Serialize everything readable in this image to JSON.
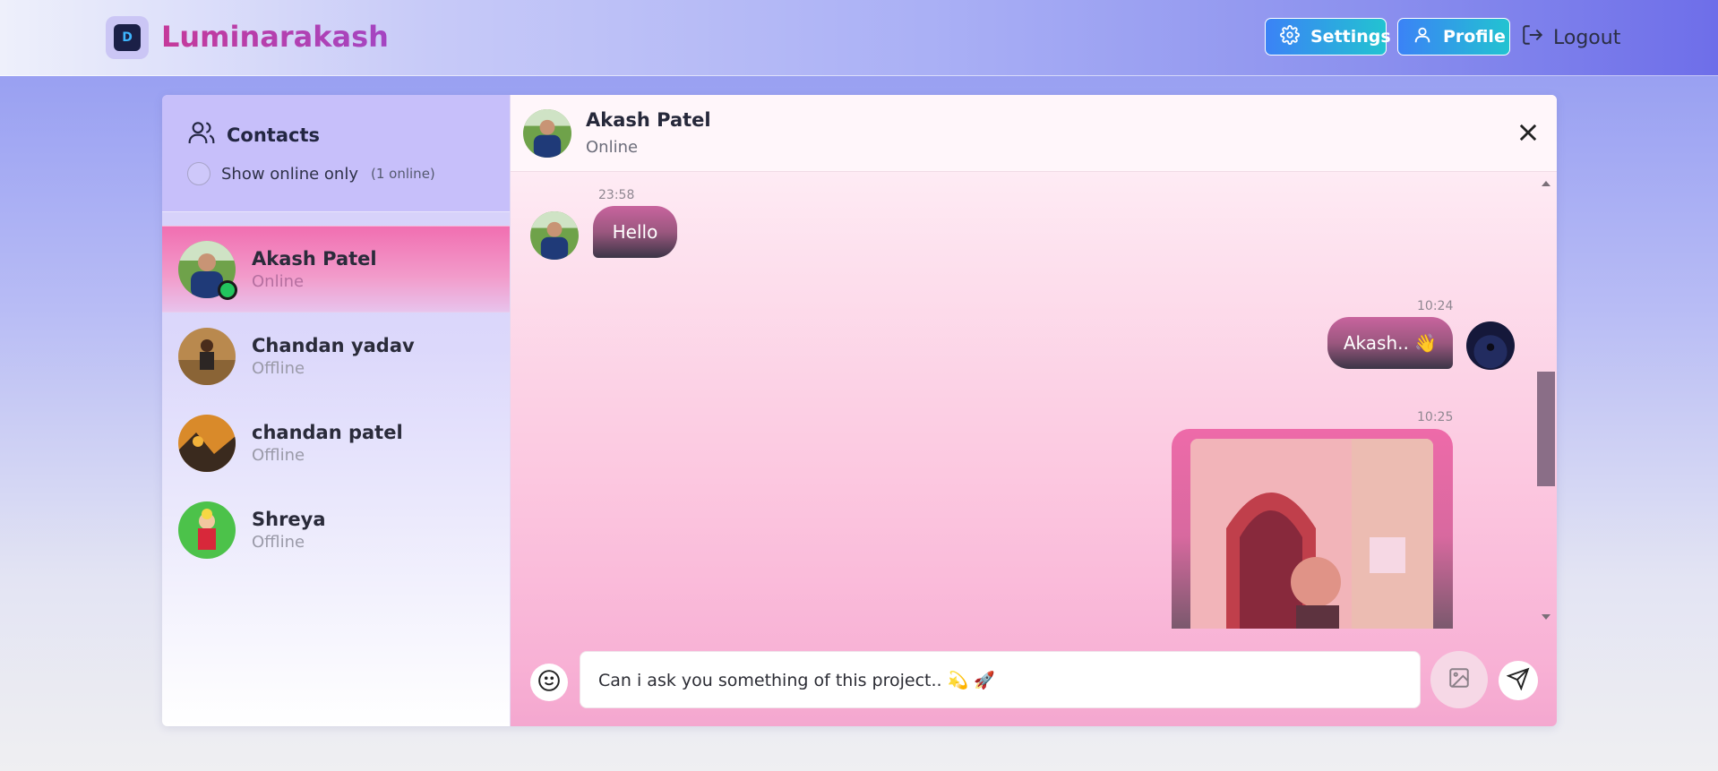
{
  "navbar": {
    "brand": "Luminarakash",
    "logo_text": "D",
    "settings_label": "Settings",
    "profile_label": "Profile",
    "logout_label": "Logout"
  },
  "sidebar": {
    "title": "Contacts",
    "filter_label": "Show online only",
    "online_count": "(1 online)",
    "contacts": [
      {
        "name": "Akash Patel",
        "status": "Online",
        "active": true
      },
      {
        "name": "Chandan yadav",
        "status": "Offline"
      },
      {
        "name": "chandan patel",
        "status": "Offline"
      },
      {
        "name": "Shreya",
        "status": "Offline"
      }
    ]
  },
  "chat": {
    "contact_name": "Akash Patel",
    "contact_status": "Online",
    "messages": [
      {
        "time": "23:58",
        "text": "Hello",
        "side": "left"
      },
      {
        "time": "10:24",
        "text": "Akash.. 👋",
        "side": "right"
      },
      {
        "time": "10:25",
        "type": "image",
        "side": "right"
      }
    ],
    "input_value": "Can i ask you something of this project.. 💫 🚀"
  },
  "icons": [
    "settings-icon",
    "user-icon",
    "logout-icon",
    "users-icon",
    "close-icon",
    "smile-icon",
    "image-icon",
    "send-icon"
  ],
  "colors": {
    "accent": "#f16fb1",
    "online": "#22c55e",
    "button": "#3b82f6"
  }
}
